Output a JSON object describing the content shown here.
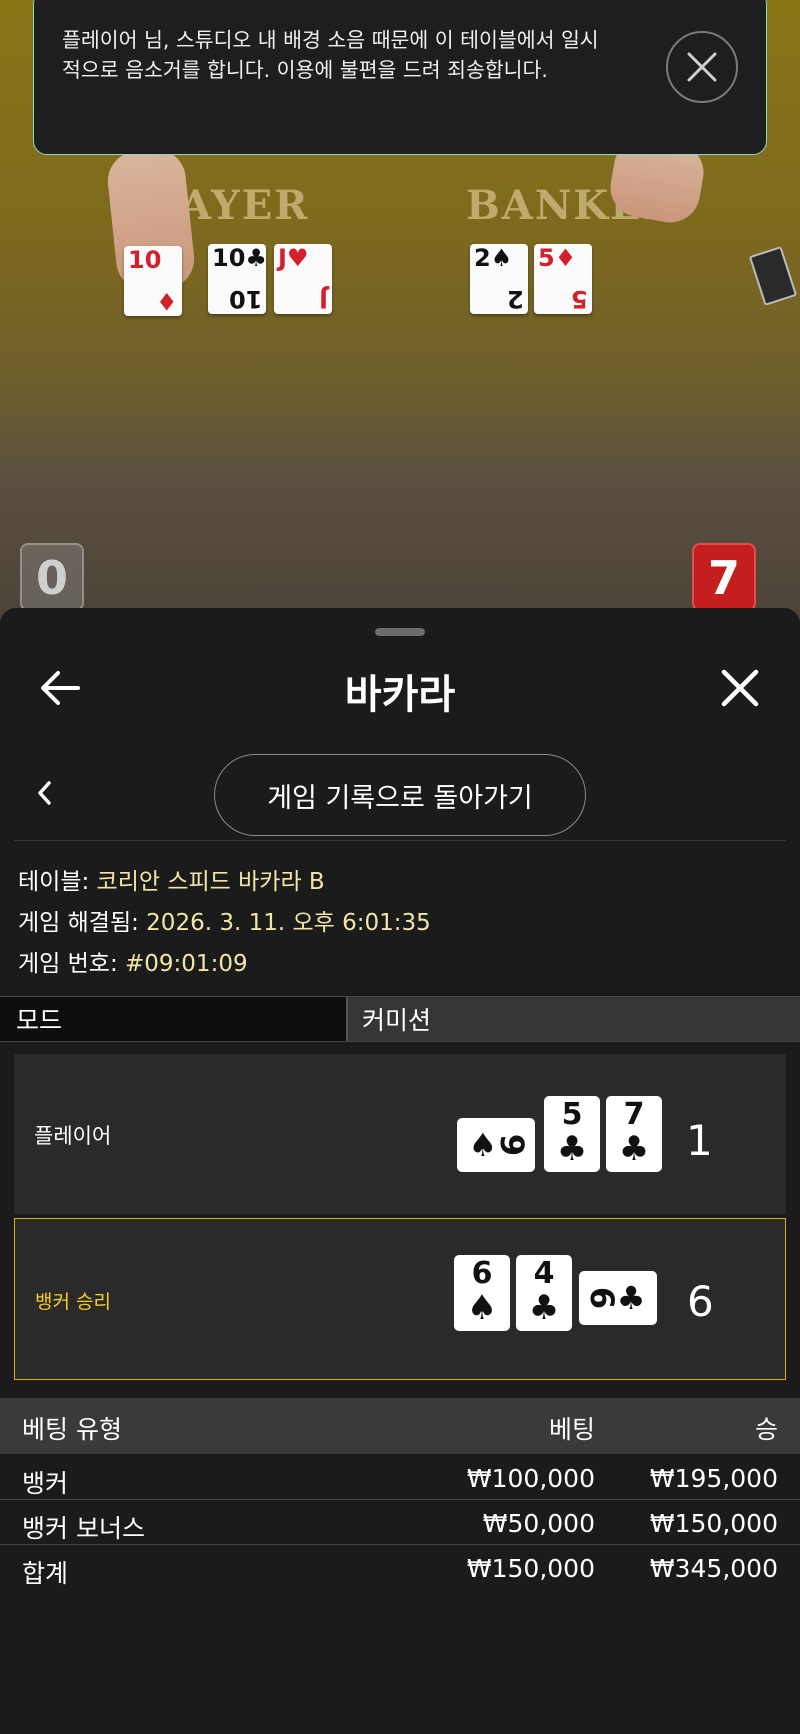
{
  "notification": {
    "message": "플레이어 님, 스튜디오 내 배경 소음 때문에 이 테이블에서 일시적으로 음소거를 합니다. 이용에 불편을 드려 죄송합니다."
  },
  "video": {
    "felt_player": "LAYER",
    "felt_banker": "BANKER",
    "player_score": "0",
    "banker_score": "7",
    "table_cards": [
      {
        "rank": "10",
        "suit": "♦",
        "color": "red"
      },
      {
        "rank": "10",
        "suit": "♣",
        "color": "black"
      },
      {
        "rank": "J",
        "suit": "♥",
        "color": "red"
      },
      {
        "rank": "2",
        "suit": "♠",
        "color": "black"
      },
      {
        "rank": "5",
        "suit": "♦",
        "color": "red"
      }
    ]
  },
  "sheet": {
    "title": "바카라",
    "history_button": "게임 기록으로 돌아가기",
    "table_label": "테이블: ",
    "table_value": "코리안 스피드 바카라 B",
    "resolved_label": "게임 해결됨: ",
    "resolved_value": "2026. 3. 11. 오후 6:01:35",
    "game_no_label": "게임 번호: ",
    "game_no_value": "#09:01:09",
    "mode_label": "모드",
    "mode_value": "커미션"
  },
  "results": {
    "player": {
      "label": "플레이어",
      "total": "1",
      "cards": [
        {
          "rank": "9",
          "suit": "♠",
          "orientation": "sideways"
        },
        {
          "rank": "5",
          "suit": "♣",
          "orientation": "upright"
        },
        {
          "rank": "7",
          "suit": "♣",
          "orientation": "upright"
        }
      ]
    },
    "banker": {
      "label": "뱅커 승리",
      "total": "6",
      "cards": [
        {
          "rank": "6",
          "suit": "♠",
          "orientation": "upright"
        },
        {
          "rank": "4",
          "suit": "♣",
          "orientation": "upright"
        },
        {
          "rank": "6",
          "suit": "♣",
          "orientation": "sideways"
        }
      ]
    }
  },
  "bets": {
    "headers": {
      "type": "베팅 유형",
      "bet": "베팅",
      "win": "승"
    },
    "rows": [
      {
        "type": "뱅커",
        "bet": "₩100,000",
        "win": "₩195,000"
      },
      {
        "type": "뱅커 보너스",
        "bet": "₩50,000",
        "win": "₩150,000"
      }
    ],
    "total": {
      "type": "합계",
      "bet": "₩150,000",
      "win": "₩345,000"
    }
  },
  "colors": {
    "accent_gold": "#f5cf1f",
    "meta_value": "#f2e6a6",
    "toast_border": "#8ad6c4",
    "banker_score_bg": "#c41e1e"
  }
}
